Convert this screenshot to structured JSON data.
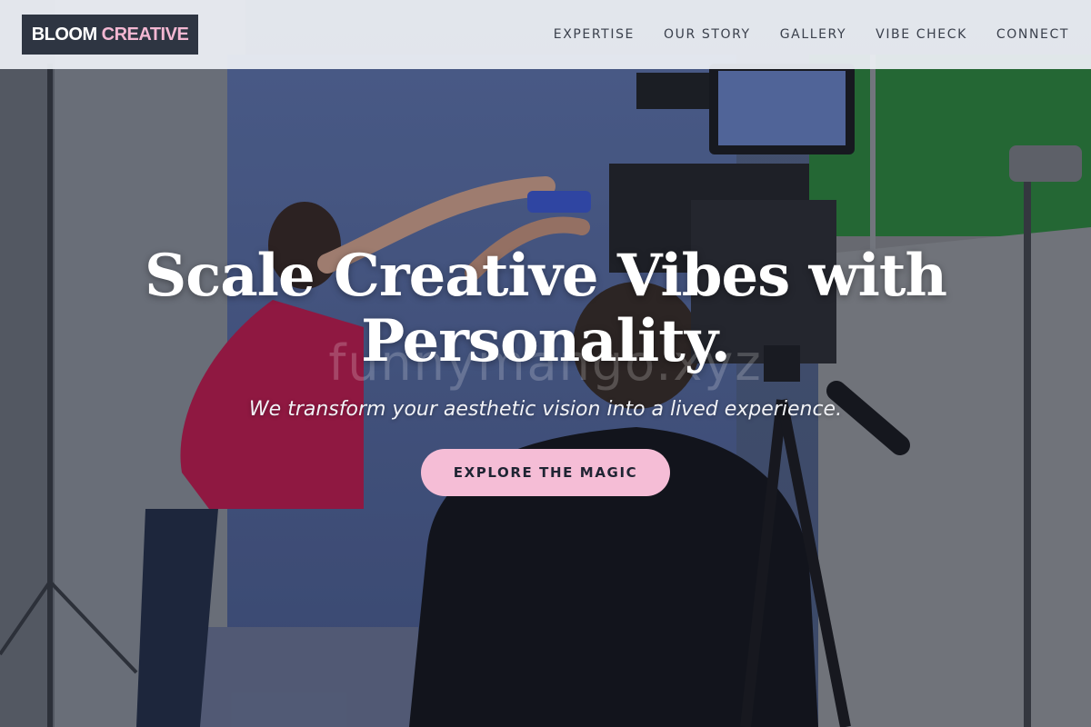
{
  "brand": {
    "name_primary": "BLOOM",
    "name_accent": "CREATIVE",
    "primary_color": "#ffffff",
    "accent_color": "#f3b7d2",
    "background_color": "#2e3542"
  },
  "nav": {
    "items": [
      {
        "label": "EXPERTISE"
      },
      {
        "label": "OUR STORY"
      },
      {
        "label": "GALLERY"
      },
      {
        "label": "VIBE CHECK"
      },
      {
        "label": "CONNECT"
      }
    ]
  },
  "hero": {
    "headline": "Scale Creative Vibes with Personality.",
    "subtitle": "We transform your aesthetic vision into a lived experience.",
    "cta_label": "EXPLORE THE MAGIC",
    "cta_color": "#f5bdd6",
    "background_image": "film-studio-photo",
    "watermark": "funnymango.xyz"
  }
}
